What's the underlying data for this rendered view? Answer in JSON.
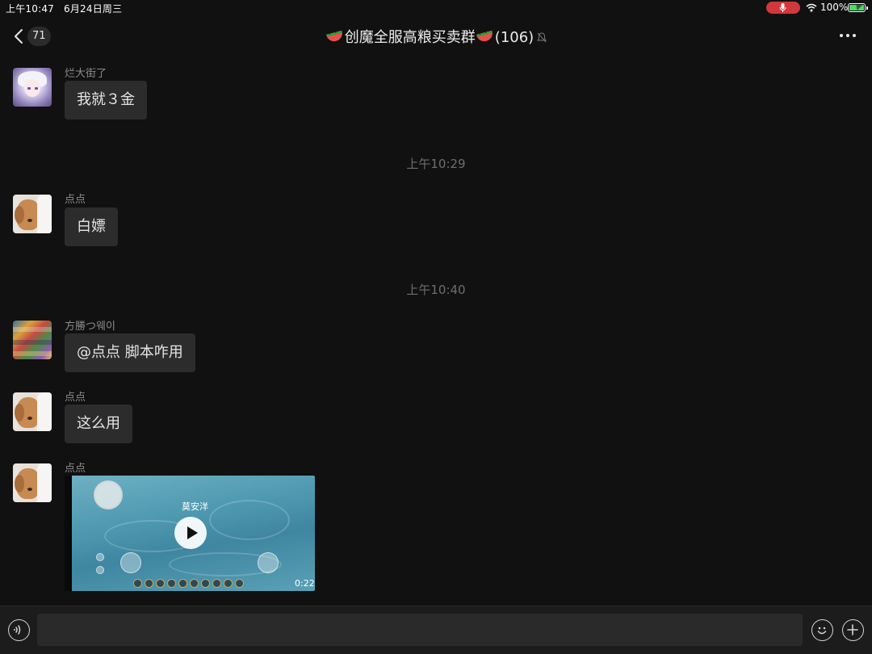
{
  "status_bar": {
    "time": "上午10:47",
    "date": "6月24日周三",
    "battery": "100%"
  },
  "nav": {
    "back_count": "71",
    "title": "创魔全服高粮买卖群",
    "member_count": "(106)"
  },
  "messages": [
    {
      "sender": "烂大街了",
      "text": "我就３金"
    },
    {
      "timestamp": "上午10:29"
    },
    {
      "sender": "点点",
      "text": "白嫖"
    },
    {
      "timestamp": "上午10:40"
    },
    {
      "sender": "方勝つ웨이",
      "text": "@点点 脚本咋用"
    },
    {
      "sender": "点点",
      "text": "这么用"
    },
    {
      "sender": "点点",
      "video": {
        "duration": "0:22",
        "overlay_name": "莫安洋"
      }
    }
  ],
  "input": {
    "value": ""
  },
  "icons": {
    "back": "chevron-left-icon",
    "mute": "bell-muted-icon",
    "more": "more-dots-icon",
    "voice": "voice-icon",
    "emoji": "emoji-icon",
    "plus": "plus-icon",
    "mic": "mic-icon",
    "wifi": "wifi-icon",
    "battery": "battery-icon",
    "emoji_title": "watermelon-icon"
  },
  "colors": {
    "background": "#111111",
    "bubble": "#2c2c2c",
    "mic_pill": "#d2383b",
    "battery_fill": "#4cd964"
  }
}
